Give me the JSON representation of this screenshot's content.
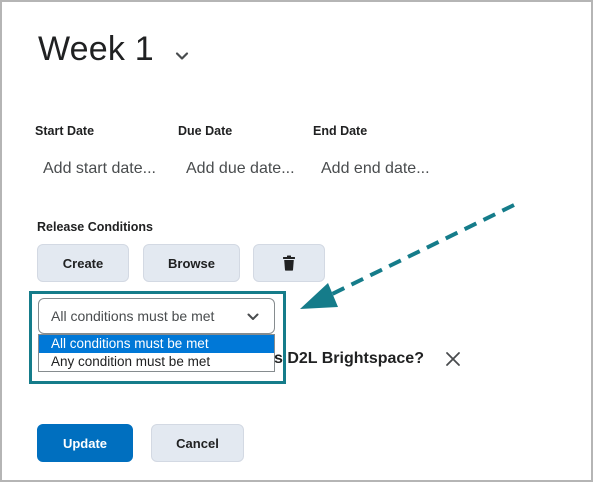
{
  "header": {
    "title": "Week 1"
  },
  "dates": [
    {
      "label": "Start Date",
      "placeholder": "Add start date..."
    },
    {
      "label": "Due Date",
      "placeholder": "Add due date..."
    },
    {
      "label": "End Date",
      "placeholder": "Add end date..."
    }
  ],
  "release_conditions": {
    "label": "Release Conditions",
    "create_label": "Create",
    "browse_label": "Browse",
    "select_value": "All conditions must be met",
    "options": [
      "All conditions must be met",
      "Any condition must be met"
    ],
    "selected_index": 0,
    "condition_text": "s D2L Brightspace?"
  },
  "footer": {
    "update_label": "Update",
    "cancel_label": "Cancel"
  },
  "colors": {
    "primary": "#006fbf",
    "secondary_button": "#e3e9f1",
    "option_highlight": "#0078d7",
    "callout": "#157c8a"
  },
  "icons": {
    "title_chevron": "chevron-down-icon",
    "delete": "trash-icon",
    "select_chevron": "chevron-down-icon",
    "remove": "close-icon",
    "callout_arrow": "dashed-arrow-icon"
  }
}
